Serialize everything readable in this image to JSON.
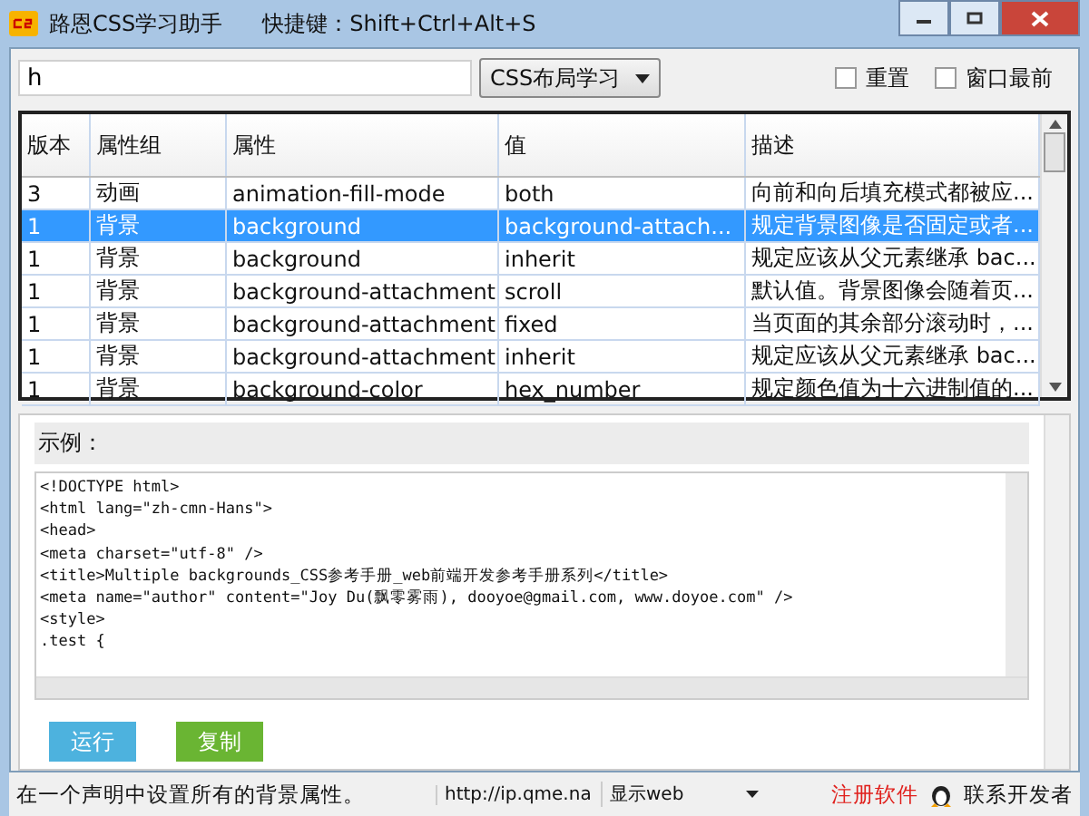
{
  "window": {
    "title": "路恩CSS学习助手",
    "shortcut": "快捷键：Shift+Ctrl+Alt+S"
  },
  "search": {
    "value": "h"
  },
  "category": {
    "value": "CSS布局学习"
  },
  "options": [
    {
      "label": "重置",
      "checked": false
    },
    {
      "label": "窗口最前",
      "checked": false
    }
  ],
  "table": {
    "columns": [
      "版本",
      "属性组",
      "属性",
      "值",
      "描述"
    ],
    "rows": [
      {
        "cells": [
          "3",
          "动画",
          "animation-fill-mode",
          "both",
          "向前和向后填充模式都被应..."
        ],
        "selected": false
      },
      {
        "cells": [
          "1",
          "背景",
          "background",
          "background-attach...",
          "规定背景图像是否固定或者..."
        ],
        "selected": true
      },
      {
        "cells": [
          "1",
          "背景",
          "background",
          "inherit",
          "规定应该从父元素继承 bac..."
        ],
        "selected": false
      },
      {
        "cells": [
          "1",
          "背景",
          "background-attachment",
          "scroll",
          "默认值。背景图像会随着页..."
        ],
        "selected": false
      },
      {
        "cells": [
          "1",
          "背景",
          "background-attachment",
          "fixed",
          "当页面的其余部分滚动时，..."
        ],
        "selected": false
      },
      {
        "cells": [
          "1",
          "背景",
          "background-attachment",
          "inherit",
          "规定应该从父元素继承 bac..."
        ],
        "selected": false
      },
      {
        "cells": [
          "1",
          "背景",
          "background-color",
          "hex_number",
          "规定颜色值为十六进制值的..."
        ],
        "selected": false
      }
    ]
  },
  "example": {
    "label": "示例：",
    "code": [
      "<!DOCTYPE html>",
      "<html lang=\"zh-cmn-Hans\">",
      "<head>",
      "<meta charset=\"utf-8\" />",
      "<title>Multiple backgrounds_CSS参考手册_web前端开发参考手册系列</title>",
      "<meta name=\"author\" content=\"Joy Du(飘零雾雨), dooyoe@gmail.com, www.doyoe.com\" />",
      "<style>",
      ".test {"
    ],
    "buttons": [
      {
        "label": "运行",
        "kind": "run"
      },
      {
        "label": "复制",
        "kind": "copy"
      }
    ]
  },
  "status_bar": {
    "message": "在一个声明中设置所有的背景属性。",
    "url": "http://ip.qme.na",
    "mode": "显示web",
    "register": "注册软件",
    "contact": "联系开发者"
  }
}
